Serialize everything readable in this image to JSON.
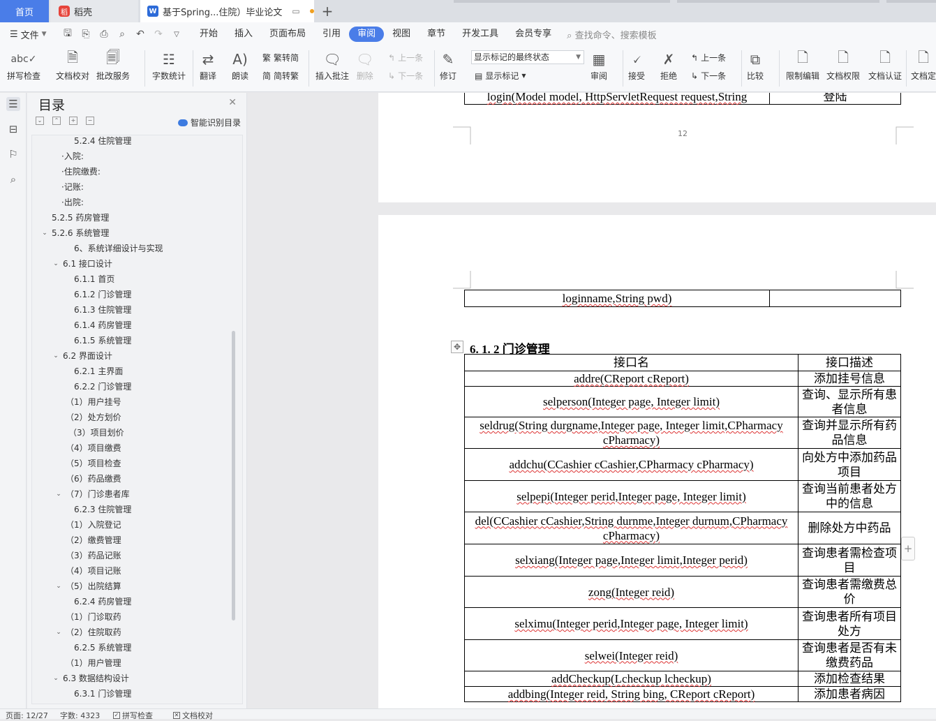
{
  "tabs": {
    "home": "首页",
    "daoke": "稻壳",
    "doc": "基于Spring...住院）毕业论文",
    "doc_badge": "W",
    "daoke_badge": "稻",
    "add": "+"
  },
  "menu": {
    "file": "文件",
    "items": [
      "开始",
      "插入",
      "页面布局",
      "引用",
      "审阅",
      "视图",
      "章节",
      "开发工具",
      "会员专享"
    ],
    "active": "审阅",
    "search": "查找命令、搜索模板"
  },
  "toolbar": {
    "spell": "拼写检查",
    "proof": "文档校对",
    "annotate_service": "批改服务",
    "wordcount": "字数统计",
    "translate": "翻译",
    "read": "朗读",
    "t2s": "繁转简",
    "s2t": "简转繁",
    "insert_comment": "插入批注",
    "delete": "删除",
    "prev_comment": "上一条",
    "next_comment": "下一条",
    "revise": "修订",
    "markup_state": "显示标记的最终状态",
    "show_markup": "显示标记",
    "review": "审阅",
    "accept": "接受",
    "reject": "拒绝",
    "prev_change": "上一条",
    "next_change": "下一条",
    "compare": "比较",
    "restrict": "限制编辑",
    "permission": "文档权限",
    "certify": "文档认证",
    "finalize": "文档定"
  },
  "toc": {
    "title": "目录",
    "ai": "智能识别目录",
    "items": [
      {
        "label": "5.2.4 住院管理",
        "indent": 60,
        "caret": ""
      },
      {
        "label": "·入院:",
        "indent": 42,
        "caret": ""
      },
      {
        "label": "·住院缴费:",
        "indent": 42,
        "caret": ""
      },
      {
        "label": "·记账:",
        "indent": 42,
        "caret": ""
      },
      {
        "label": "·出院:",
        "indent": 42,
        "caret": ""
      },
      {
        "label": "5.2.5 药房管理",
        "indent": 28,
        "caret": ""
      },
      {
        "label": "5.2.6 系统管理",
        "indent": 28,
        "caret": "v"
      },
      {
        "label": "6、系统详细设计与实现",
        "indent": 60,
        "caret": ""
      },
      {
        "label": "6.1 接口设计",
        "indent": 44,
        "caret": "v"
      },
      {
        "label": "6.1.1 首页",
        "indent": 60,
        "caret": ""
      },
      {
        "label": "6.1.2 门诊管理",
        "indent": 60,
        "caret": ""
      },
      {
        "label": "6.1.3 住院管理",
        "indent": 60,
        "caret": ""
      },
      {
        "label": "6.1.4 药房管理",
        "indent": 60,
        "caret": ""
      },
      {
        "label": "6.1.5 系统管理",
        "indent": 60,
        "caret": ""
      },
      {
        "label": "6.2 界面设计",
        "indent": 44,
        "caret": "v"
      },
      {
        "label": "6.2.1 主界面",
        "indent": 60,
        "caret": ""
      },
      {
        "label": "6.2.2 门诊管理",
        "indent": 60,
        "caret": ""
      },
      {
        "label": "（1）用户挂号",
        "indent": 48,
        "caret": ""
      },
      {
        "label": "（2）处方划价",
        "indent": 48,
        "caret": ""
      },
      {
        "label": "（3）项目划价",
        "indent": 52,
        "caret": ""
      },
      {
        "label": "（4）项目缴费",
        "indent": 48,
        "caret": ""
      },
      {
        "label": "（5）项目检查",
        "indent": 48,
        "caret": ""
      },
      {
        "label": "（6）药品缴费",
        "indent": 48,
        "caret": ""
      },
      {
        "label": "（7）门诊患者库",
        "indent": 48,
        "caret": "v"
      },
      {
        "label": "6.2.3 住院管理",
        "indent": 60,
        "caret": ""
      },
      {
        "label": "（1）入院登记",
        "indent": 48,
        "caret": ""
      },
      {
        "label": "（2）缴费管理",
        "indent": 48,
        "caret": ""
      },
      {
        "label": "（3）药品记账",
        "indent": 48,
        "caret": ""
      },
      {
        "label": "（4）项目记账",
        "indent": 48,
        "caret": ""
      },
      {
        "label": "（5）出院结算",
        "indent": 48,
        "caret": "v"
      },
      {
        "label": "6.2.4 药房管理",
        "indent": 60,
        "caret": ""
      },
      {
        "label": "（1）门诊取药",
        "indent": 48,
        "caret": ""
      },
      {
        "label": "（2）住院取药",
        "indent": 48,
        "caret": "v"
      },
      {
        "label": "6.2.5 系统管理",
        "indent": 60,
        "caret": ""
      },
      {
        "label": "（1）用户管理",
        "indent": 48,
        "caret": ""
      },
      {
        "label": "6.3 数据结构设计",
        "indent": 44,
        "caret": "v"
      },
      {
        "label": "6.3.1 门诊管理",
        "indent": 60,
        "caret": ""
      }
    ]
  },
  "document": {
    "page1_row": [
      "login(Model model, HttpServletRequest request,String",
      "登陆"
    ],
    "page_number": "12",
    "page2_row": [
      "loginname,String pwd)",
      ""
    ],
    "section_heading": "6. 1. 2 门诊管理",
    "table_header": [
      "接口名",
      "接口描述"
    ],
    "table_rows": [
      [
        "addre(CReport cReport)",
        "添加挂号信息"
      ],
      [
        "selperson(Integer page, Integer limit)",
        "查询、显示所有患者信息"
      ],
      [
        "seldrug(String durgname,Integer page, Integer limit,CPharmacy cPharmacy)",
        "查询并显示所有药品信息"
      ],
      [
        "addchu(CCashier cCashier,CPharmacy cPharmacy)",
        "向处方中添加药品项目"
      ],
      [
        "selpepi(Integer perid,Integer page, Integer limit)",
        "查询当前患者处方中的信息"
      ],
      [
        "del(CCashier cCashier,String durnme,Integer durnum,CPharmacy cPharmacy)",
        "删除处方中药品"
      ],
      [
        "selxiang(Integer page,Integer limit,Integer perid)",
        "查询患者需检查项目"
      ],
      [
        "zong(Integer reid)",
        "查询患者需缴费总价"
      ],
      [
        "selximu(Integer perid,Integer page, Integer limit)",
        "查询患者所有项目处方"
      ],
      [
        "selwei(Integer reid)",
        "查询患者是否有未缴费药品"
      ],
      [
        "addCheckup(Lcheckup lcheckup)",
        "添加检查结果"
      ],
      [
        "addbing(Integer reid, String bing, CReport cReport)",
        "添加患者病因"
      ]
    ]
  },
  "status": {
    "page": "页面: 12/27",
    "words": "字数: 4323",
    "spell": "拼写检查",
    "proof": "文档校对"
  }
}
